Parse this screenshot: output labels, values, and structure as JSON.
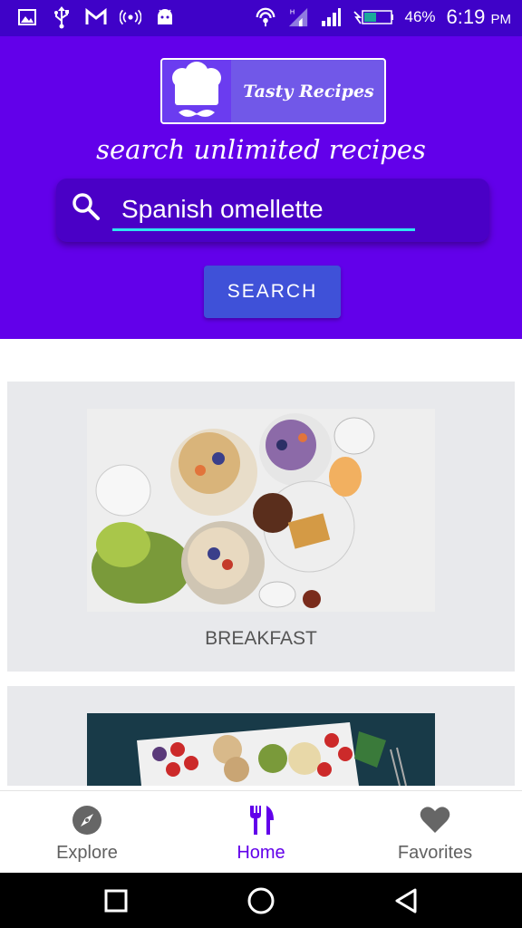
{
  "status_bar": {
    "battery": "46%",
    "time": "6:19",
    "ampm": "PM"
  },
  "header": {
    "logo_text": "Tasty Recipes",
    "tagline": "search unlimited recipes",
    "search": {
      "value": "Spanish omellette",
      "placeholder": ""
    },
    "search_button": "SEARCH"
  },
  "categories": [
    {
      "label": "BREAKFAST"
    },
    {
      "label": ""
    }
  ],
  "bottom_nav": {
    "items": [
      {
        "label": "Explore",
        "icon": "compass-icon"
      },
      {
        "label": "Home",
        "icon": "fork-knife-icon",
        "active": true
      },
      {
        "label": "Favorites",
        "icon": "heart-icon"
      }
    ]
  },
  "colors": {
    "status_bar": "#3f02c8",
    "header": "#6200ea",
    "accent": "#2ee4f0",
    "button": "#3f51d8",
    "card": "#e8e9ec"
  }
}
